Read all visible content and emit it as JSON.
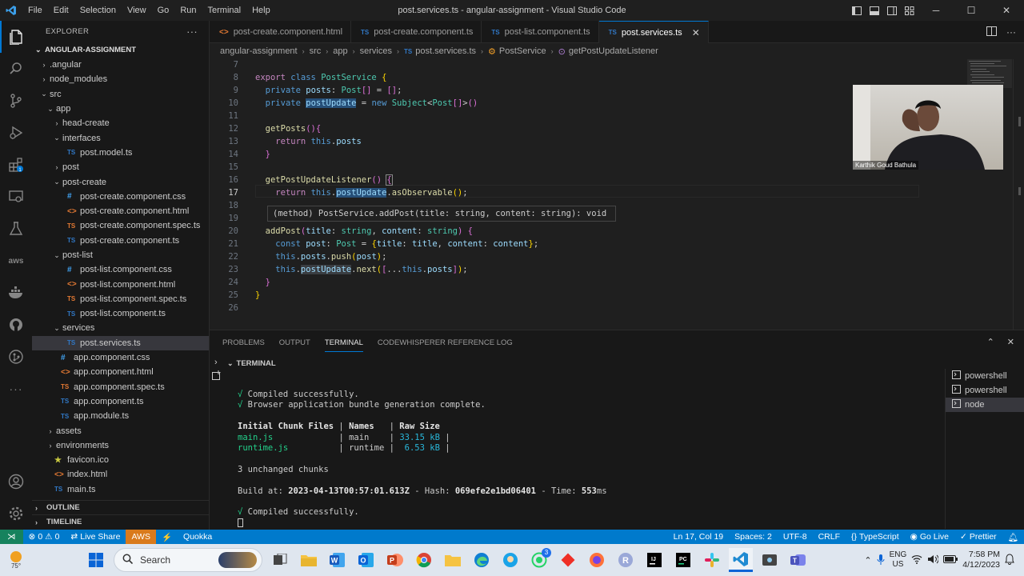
{
  "window": {
    "title": "post.services.ts - angular-assignment - Visual Studio Code",
    "menu": [
      "File",
      "Edit",
      "Selection",
      "View",
      "Go",
      "Run",
      "Terminal",
      "Help"
    ]
  },
  "explorer": {
    "header": "EXPLORER",
    "more": "···",
    "root": "ANGULAR-ASSIGNMENT",
    "items": [
      {
        "label": ".angular",
        "type": "folder",
        "open": false,
        "depth": 1
      },
      {
        "label": "node_modules",
        "type": "folder",
        "open": false,
        "depth": 1
      },
      {
        "label": "src",
        "type": "folder",
        "open": true,
        "depth": 1
      },
      {
        "label": "app",
        "type": "folder",
        "open": true,
        "depth": 2
      },
      {
        "label": "head-create",
        "type": "folder",
        "open": false,
        "depth": 3
      },
      {
        "label": "interfaces",
        "type": "folder",
        "open": true,
        "depth": 3
      },
      {
        "label": "post.model.ts",
        "type": "ts",
        "depth": 4
      },
      {
        "label": "post",
        "type": "folder",
        "open": false,
        "depth": 3
      },
      {
        "label": "post-create",
        "type": "folder",
        "open": true,
        "depth": 3
      },
      {
        "label": "post-create.component.css",
        "type": "css",
        "depth": 4
      },
      {
        "label": "post-create.component.html",
        "type": "html",
        "depth": 4
      },
      {
        "label": "post-create.component.spec.ts",
        "type": "spec",
        "depth": 4
      },
      {
        "label": "post-create.component.ts",
        "type": "ts",
        "depth": 4
      },
      {
        "label": "post-list",
        "type": "folder",
        "open": true,
        "depth": 3
      },
      {
        "label": "post-list.component.css",
        "type": "css",
        "depth": 4
      },
      {
        "label": "post-list.component.html",
        "type": "html",
        "depth": 4
      },
      {
        "label": "post-list.component.spec.ts",
        "type": "spec",
        "depth": 4
      },
      {
        "label": "post-list.component.ts",
        "type": "ts",
        "depth": 4
      },
      {
        "label": "services",
        "type": "folder",
        "open": true,
        "depth": 3
      },
      {
        "label": "post.services.ts",
        "type": "ts",
        "depth": 4,
        "selected": true
      },
      {
        "label": "app.component.css",
        "type": "css",
        "depth": 3
      },
      {
        "label": "app.component.html",
        "type": "html",
        "depth": 3
      },
      {
        "label": "app.component.spec.ts",
        "type": "spec",
        "depth": 3
      },
      {
        "label": "app.component.ts",
        "type": "ts",
        "depth": 3
      },
      {
        "label": "app.module.ts",
        "type": "ts",
        "depth": 3
      },
      {
        "label": "assets",
        "type": "folder",
        "open": false,
        "depth": 2
      },
      {
        "label": "environments",
        "type": "folder",
        "open": false,
        "depth": 2
      },
      {
        "label": "favicon.ico",
        "type": "star",
        "depth": 2
      },
      {
        "label": "index.html",
        "type": "html",
        "depth": 2
      },
      {
        "label": "main.ts",
        "type": "ts",
        "depth": 2
      }
    ],
    "outline": "OUTLINE",
    "timeline": "TIMELINE"
  },
  "tabs": [
    {
      "label": "post-create.component.html",
      "icon": "html"
    },
    {
      "label": "post-create.component.ts",
      "icon": "TS"
    },
    {
      "label": "post-list.component.ts",
      "icon": "TS"
    },
    {
      "label": "post.services.ts",
      "icon": "TS",
      "active": true
    }
  ],
  "breadcrumbs": [
    "angular-assignment",
    "src",
    "app",
    "services",
    "post.services.ts",
    "PostService",
    "getPostUpdateListener"
  ],
  "editor": {
    "line_numbers": [
      "7",
      "8",
      "9",
      "10",
      "11",
      "12",
      "13",
      "14",
      "15",
      "16",
      "17",
      "18",
      "19",
      "20",
      "21",
      "22",
      "23",
      "24",
      "25",
      "26"
    ],
    "current_line": "17",
    "hover": "(method) PostService.addPost(title: string, content: string): void"
  },
  "webcam": {
    "name": "Karthik Goud Bathula"
  },
  "panel": {
    "tabs": [
      "PROBLEMS",
      "OUTPUT",
      "TERMINAL",
      "CODEWHISPERER REFERENCE LOG"
    ],
    "active_tab": "TERMINAL",
    "section": "TERMINAL",
    "terminals": [
      "powershell",
      "powershell",
      "node"
    ],
    "output": {
      "compiled1": "Compiled successfully.",
      "bundle": "Browser application bundle generation complete.",
      "table_header": [
        "Initial Chunk Files",
        "Names",
        "Raw Size"
      ],
      "rows": [
        [
          "main.js",
          "main",
          "33.15 kB"
        ],
        [
          "runtime.js",
          "runtime",
          "6.53 kB"
        ]
      ],
      "unchanged": "3 unchanged chunks",
      "build_prefix": "Build at: ",
      "build_time": "2023-04-13T00:57:01.613Z",
      "hash_prefix": " - Hash: ",
      "hash": "069efe2e1bd06401",
      "time_prefix": " - Time: ",
      "time": "553",
      "time_unit": "ms",
      "compiled2": "Compiled successfully."
    }
  },
  "status": {
    "problems": "0",
    "warnings": "0",
    "live_share": "Live Share",
    "aws": "AWS",
    "quokka": "Quokka",
    "position": "Ln 17, Col 19",
    "spaces": "Spaces: 2",
    "encoding": "UTF-8",
    "eol": "CRLF",
    "language": "TypeScript",
    "go_live": "Go Live",
    "prettier": "Prettier"
  },
  "taskbar": {
    "weather_temp": "75°",
    "search_placeholder": "Search",
    "lang_top": "ENG",
    "lang_bottom": "US",
    "time": "7:58 PM",
    "date": "4/12/2023",
    "whatsapp_badge": "3"
  },
  "colors": {
    "statusbar": "#007acc",
    "remote": "#16825d",
    "aws": "#d97a1c",
    "accent": "#0078d4"
  }
}
